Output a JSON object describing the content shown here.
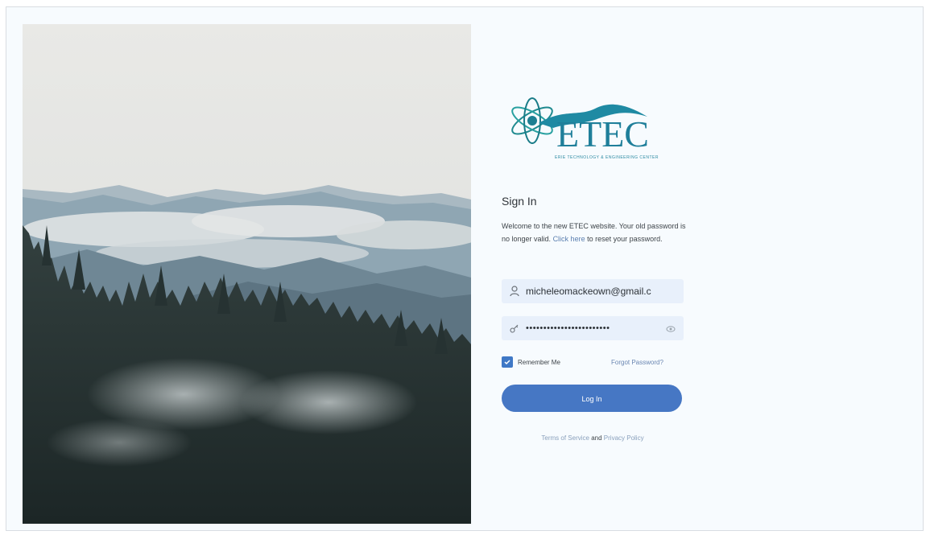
{
  "logo": {
    "name": "ETEC",
    "tagline": "ERIE TECHNOLOGY & ENGINEERING CENTER"
  },
  "signin": {
    "title": "Sign In",
    "intro_text": "Welcome to the new ETEC website. Your old password is no longer valid.",
    "intro_link": "Click here",
    "intro_tail": "to reset your password."
  },
  "email": {
    "value": "micheleomackeown@gmail.c",
    "icon": "user-icon"
  },
  "password": {
    "value": "••••••••••••••••••••••••",
    "icon": "key-icon",
    "toggle_icon": "eye-icon"
  },
  "remember": {
    "label": "Remember Me",
    "checked": true
  },
  "forgot_label": "Forgot Password?",
  "login_label": "Log In",
  "legal": {
    "terms": "Terms of Service",
    "and": "and",
    "privacy": "Privacy Policy"
  },
  "colors": {
    "primary": "#4677c4",
    "link": "#6a86b2",
    "logo_teal": "#1f7f9a",
    "field_bg": "#e8f0fb"
  }
}
